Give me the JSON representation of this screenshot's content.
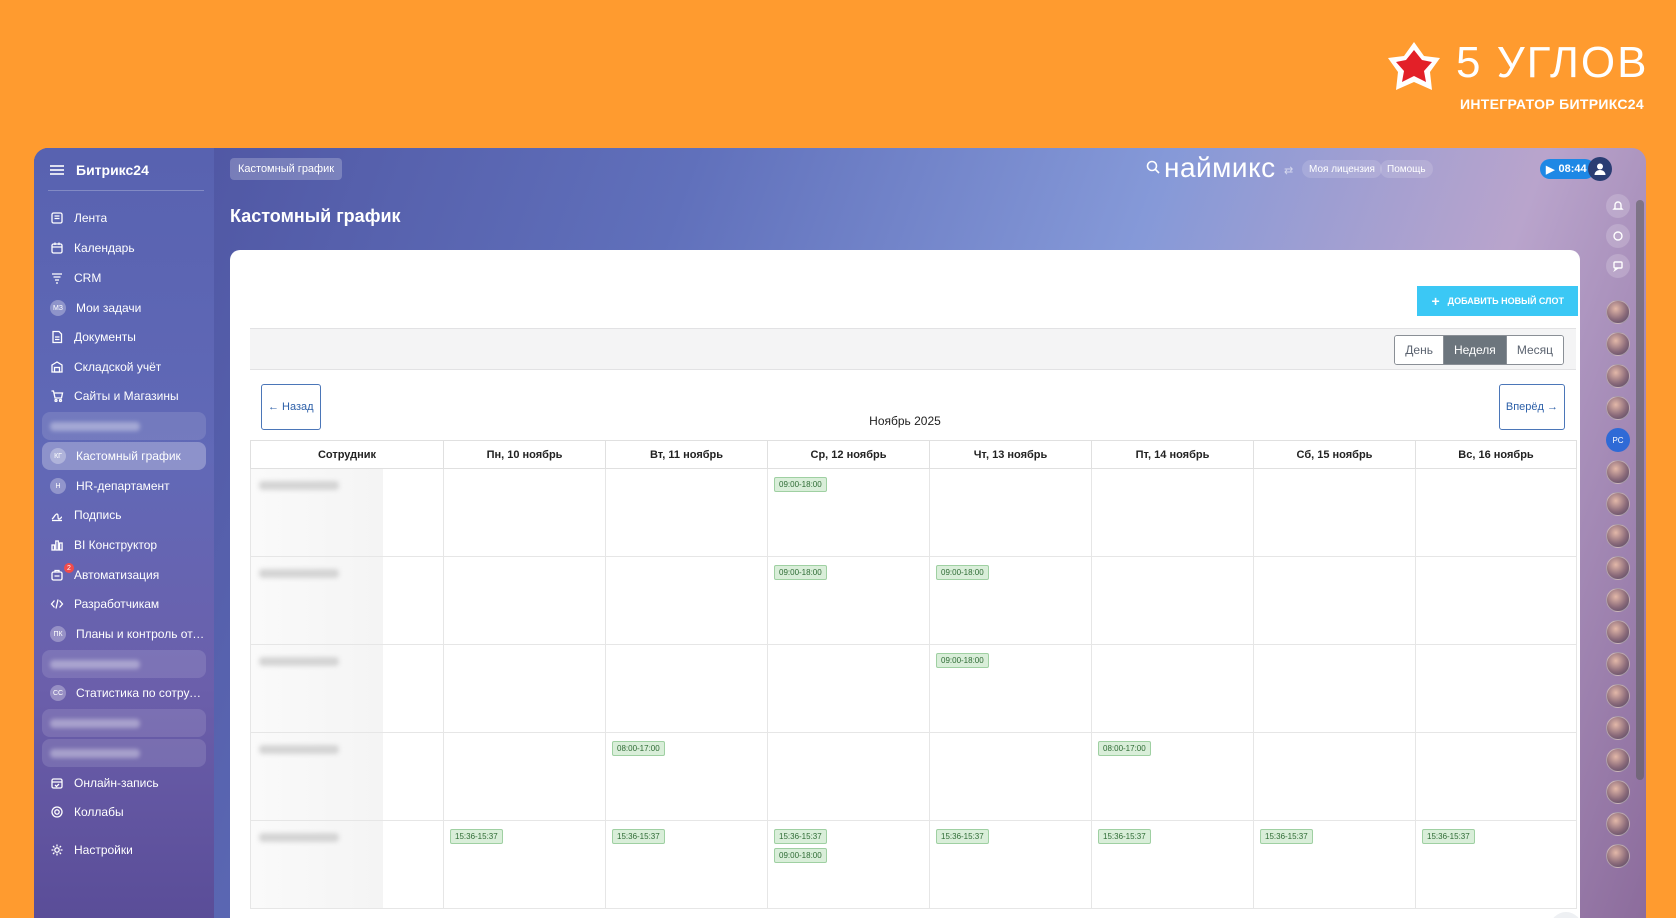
{
  "brand": {
    "name": "5 УГЛОВ",
    "subtitle": "ИНТЕГРАТОР БИТРИКС24"
  },
  "sidebar": {
    "logo": "Битрикс24",
    "items": [
      {
        "label": "Лента",
        "icon": "feed-icon"
      },
      {
        "label": "Календарь",
        "icon": "calendar-icon"
      },
      {
        "label": "CRM",
        "icon": "crm-icon"
      },
      {
        "label": "Мои задачи",
        "avatar": "МЗ"
      },
      {
        "label": "Документы",
        "icon": "document-icon"
      },
      {
        "label": "Складской учёт",
        "icon": "warehouse-icon"
      },
      {
        "label": "Сайты и Магазины",
        "icon": "cart-icon"
      },
      {
        "label": "",
        "blurred": true
      },
      {
        "label": "Кастомный график",
        "avatar": "КГ",
        "active": true
      },
      {
        "label": "HR-департамент",
        "avatar": "H"
      },
      {
        "label": "Подпись",
        "icon": "signature-icon"
      },
      {
        "label": "BI Конструктор",
        "icon": "bar-chart-icon"
      },
      {
        "label": "Автоматизация",
        "icon": "automation-icon",
        "badge": "2"
      },
      {
        "label": "Разработчикам",
        "icon": "code-icon"
      },
      {
        "label": "Планы и контроль отд...",
        "avatar": "ПК"
      },
      {
        "label": "",
        "blurred": true
      },
      {
        "label": "Статистика по сотруд...",
        "avatar": "СС"
      },
      {
        "label": "",
        "blurred": true
      },
      {
        "label": "",
        "blurred": true
      },
      {
        "label": "Онлайн-запись",
        "icon": "booking-icon"
      },
      {
        "label": "Коллабы",
        "icon": "collab-icon"
      },
      {
        "label": "Настройки",
        "icon": "gear-icon"
      }
    ]
  },
  "header": {
    "breadcrumb": "Кастомный график",
    "brand": "наймикс",
    "license": "Моя лицензия",
    "help": "Помощь",
    "timer": "08:44"
  },
  "page": {
    "title": "Кастомный график"
  },
  "toolbar": {
    "add_slot": "ДОБАВИТЬ НОВЫЙ СЛОТ",
    "views": [
      "День",
      "Неделя",
      "Месяц"
    ],
    "active_view": "Неделя",
    "prev": "← Назад",
    "next": "Вперёд →",
    "month": "Ноябрь 2025"
  },
  "schedule": {
    "columns": [
      "Сотрудник",
      "Пн, 10 ноябрь",
      "Вт, 11 ноябрь",
      "Ср, 12 ноябрь",
      "Чт, 13 ноябрь",
      "Пт, 14 ноябрь",
      "Сб, 15 ноябрь",
      "Вс, 16 ноябрь"
    ],
    "rows": [
      {
        "cells": [
          [],
          [],
          [
            "09:00-18:00"
          ],
          [],
          [],
          [],
          []
        ]
      },
      {
        "cells": [
          [],
          [],
          [
            "09:00-18:00"
          ],
          [
            "09:00-18:00"
          ],
          [],
          [],
          []
        ]
      },
      {
        "cells": [
          [],
          [],
          [],
          [
            "09:00-18:00"
          ],
          [],
          [],
          []
        ]
      },
      {
        "cells": [
          [],
          [
            "08:00-17:00"
          ],
          [],
          [],
          [
            "08:00-17:00"
          ],
          [],
          []
        ]
      },
      {
        "cells": [
          [
            "15:36-15:37"
          ],
          [
            "15:36-15:37"
          ],
          [
            "15:36-15:37",
            "09:00-18:00"
          ],
          [
            "15:36-15:37"
          ],
          [
            "15:36-15:37"
          ],
          [
            "15:36-15:37"
          ],
          [
            "15:36-15:37"
          ]
        ]
      }
    ]
  },
  "rail": {
    "initials": "РС"
  },
  "colors": {
    "background": "#FF9B2F",
    "accent": "#3BC8F5",
    "slot": "#D9EED9",
    "timer": "#1E88E5"
  }
}
